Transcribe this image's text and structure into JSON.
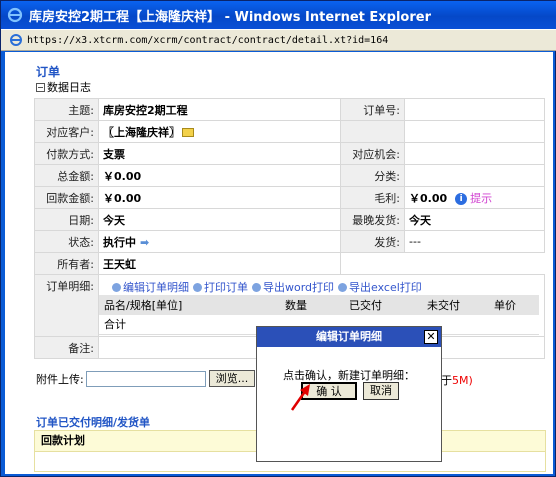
{
  "window": {
    "title": "库房安控2期工程【上海隆庆祥】 - Windows Internet Explorer",
    "url": "https://x3.xtcrm.com/xcrm/contract/contract/detail.xt?id=164"
  },
  "page": {
    "section_title": "订单",
    "data_log": "数据日志",
    "fields": {
      "subject_label": "主题:",
      "subject_value": "库房安控2期工程",
      "order_no_label": "订单号:",
      "order_no_value": "",
      "customer_label": "对应客户:",
      "customer_value": "〖上海隆庆祥〗",
      "payment_label": "付款方式:",
      "payment_value": "支票",
      "opportunity_label": "对应机会:",
      "opportunity_value": "",
      "total_label": "总金额:",
      "total_value": "￥0.00",
      "category_label": "分类:",
      "category_value": "",
      "received_label": "回款金额:",
      "received_value": "￥0.00",
      "profit_label": "毛利:",
      "profit_value": "￥0.00",
      "profit_tip": "提示",
      "date_label": "日期:",
      "date_value": "今天",
      "latest_ship_label": "最晚发货:",
      "latest_ship_value": "今天",
      "status_label": "状态:",
      "status_value": "执行中",
      "shipped_label": "发货:",
      "shipped_value": "---",
      "owner_label": "所有者:",
      "owner_value": "王天虹",
      "items_label": "订单明细:",
      "remark_label": "备注:"
    },
    "item_actions": [
      "编辑订单明细",
      "打印订单",
      "导出word打印",
      "导出excel打印"
    ],
    "items_columns": [
      "品名/规格[单位]",
      "数量",
      "已交付",
      "未交付",
      "单价"
    ],
    "items_total": "合计",
    "attach_label": "附件上传:",
    "browse_button": "浏览...",
    "attach_hint_prefix": "于",
    "attach_hint_size": "5M)",
    "delivered_title": "订单已交付明细/发货单",
    "payment_plan": "回款计划"
  },
  "dialog": {
    "title": "编辑订单明细",
    "message": "点击确认，新建订单明细：",
    "ok": "确 认",
    "cancel": "取消"
  }
}
